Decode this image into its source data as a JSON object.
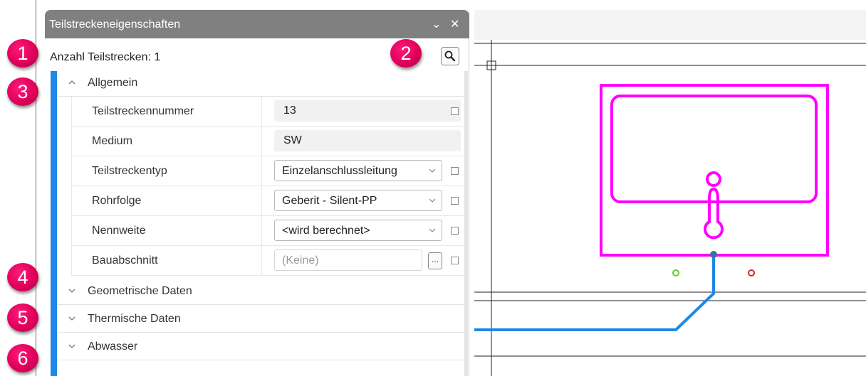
{
  "window": {
    "title": "Teilstreckeneigenschaften",
    "menu_glyph": "⌄",
    "close_glyph": "✕"
  },
  "header": {
    "count_text": "Anzahl Teilstrecken: 1",
    "search_icon": "magnifier-icon"
  },
  "sections": {
    "general": "Allgemein",
    "geometry": "Geometrische Daten",
    "thermal": "Thermische Daten",
    "wastewater": "Abwasser"
  },
  "properties": [
    {
      "label": "Teilstreckennummer",
      "value": "13"
    },
    {
      "label": "Medium",
      "value": "SW"
    },
    {
      "label": "Teilstreckentyp",
      "value": "Einzelanschlussleitung"
    },
    {
      "label": "Rohrfolge",
      "value": "Geberit - Silent-PP"
    },
    {
      "label": "Nennweite",
      "value": "<wird berechnet>"
    },
    {
      "label": "Bauabschnitt",
      "value": "(Keine)"
    }
  ],
  "ellipsis_label": "...",
  "badges": [
    "1",
    "2",
    "3",
    "4",
    "5",
    "6"
  ],
  "colors": {
    "accent": "#1e88e5",
    "badge": "#e0005a",
    "fixture": "#ff00ff",
    "pipe": "#1e88e5",
    "cold_port": "#66cc22",
    "hot_port": "#dd2222"
  }
}
